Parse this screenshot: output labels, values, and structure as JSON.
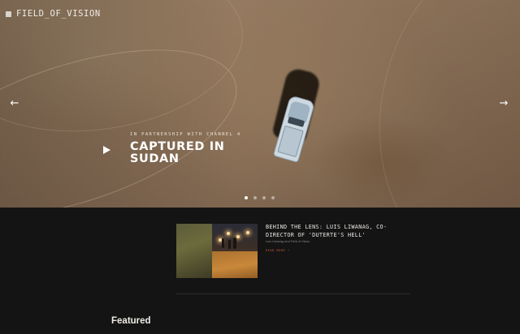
{
  "site": {
    "logo_text": "FIELD_OF_VISION"
  },
  "hero": {
    "kicker": "IN PARTNERSHIP WITH CHANNEL 4",
    "title": "CAPTURED IN SUDAN",
    "prev_icon": "←",
    "next_icon": "→",
    "play_icon": "play-icon",
    "slide_count": 4,
    "active_slide": 1
  },
  "story": {
    "title": "BEHIND THE LENS: LUIS LIWANAG, CO-DIRECTOR OF 'DUTERTE'S HELL'",
    "byline": "Luis Liwanag and Field of Vision",
    "link_label": "READ MORE →"
  },
  "featured": {
    "heading": "Featured"
  },
  "colors": {
    "page_bg": "#141414",
    "accent_link": "#c05a3d",
    "text_light": "#efece7"
  }
}
